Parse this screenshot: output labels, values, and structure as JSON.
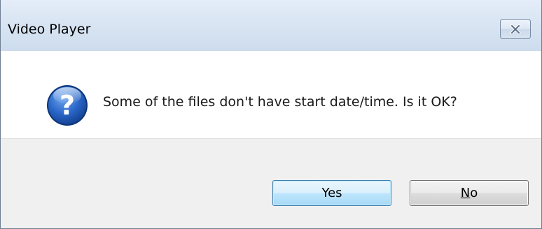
{
  "window": {
    "title": "Video Player"
  },
  "icons": {
    "close": "close-icon",
    "question": "question-icon"
  },
  "message": {
    "text": "Some of the files don't have start date/time. Is it OK?"
  },
  "buttons": {
    "yes_label": "Yes",
    "no_mnemonic": "N",
    "no_rest": "o"
  },
  "colors": {
    "title_bar": "#d9e5f3",
    "footer": "#f0f0f0",
    "default_button_border": "#3c7fb1",
    "question_icon": "#1c5bb8"
  }
}
